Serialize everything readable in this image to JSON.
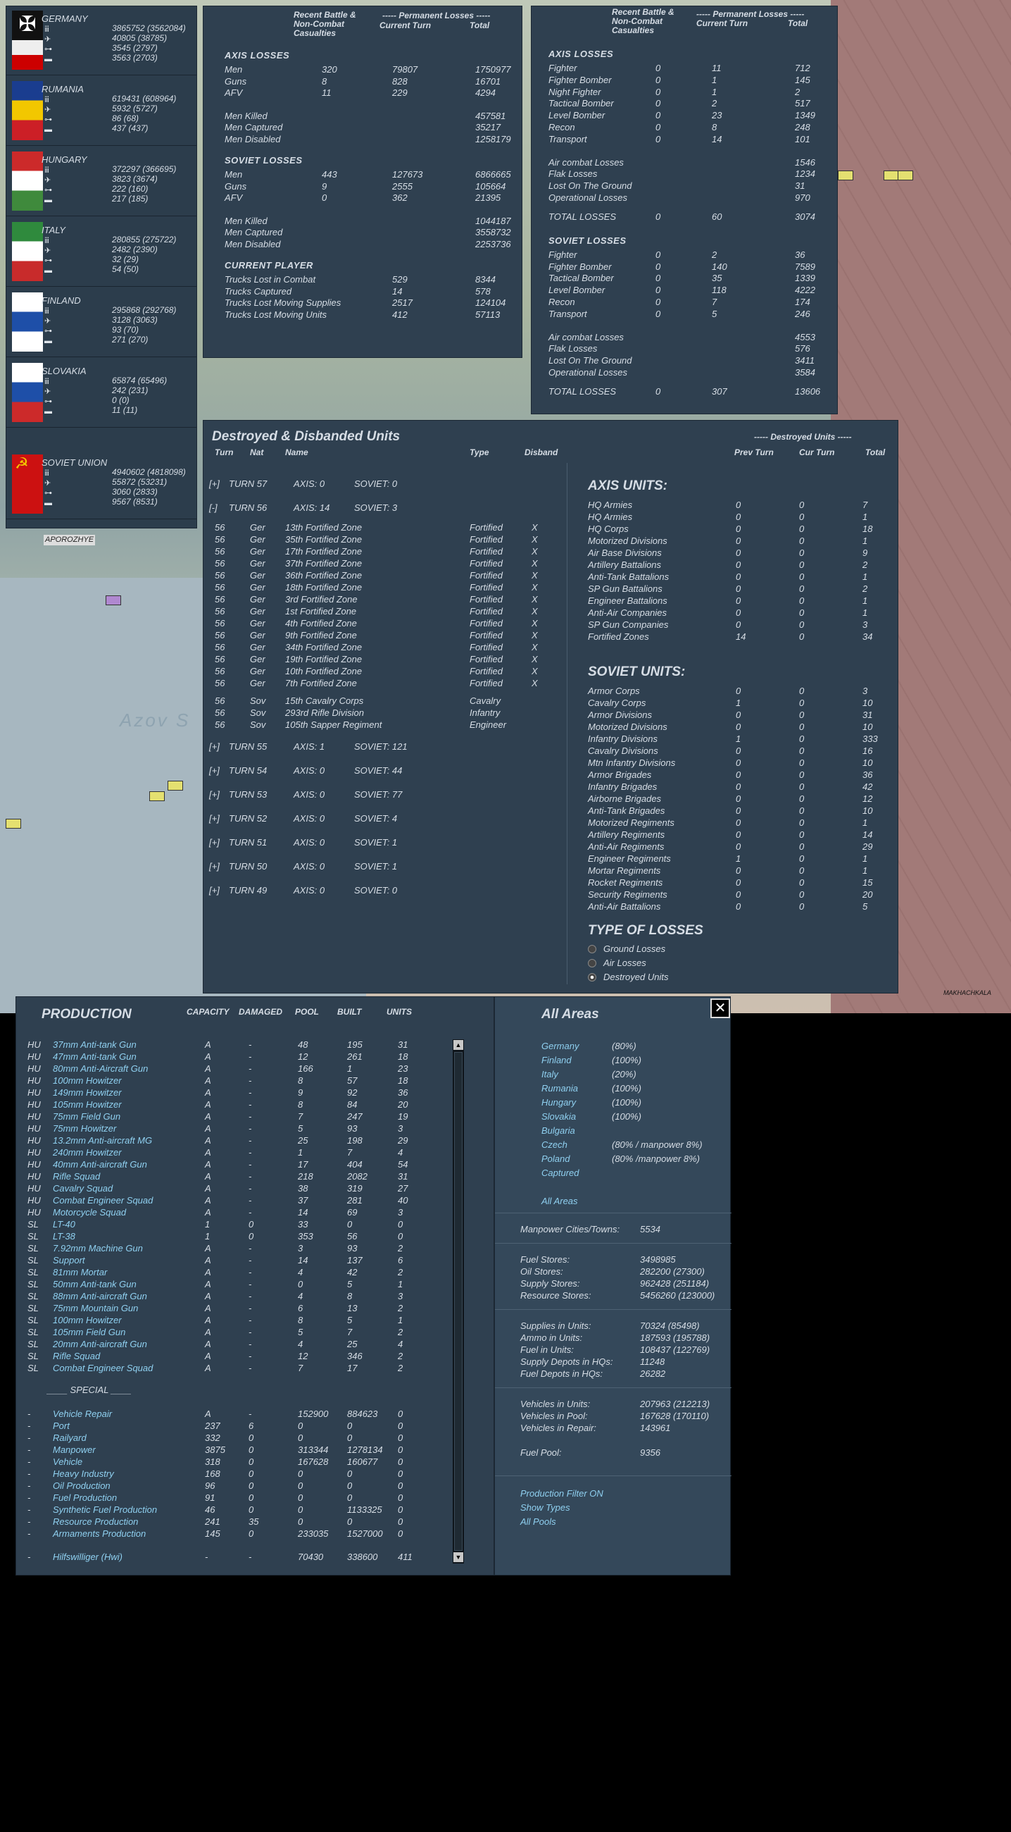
{
  "nations": [
    {
      "name": "GERMANY",
      "vals": [
        "3865752 (3562084)",
        "40805 (38785)",
        "3545 (2797)",
        "3563 (2703)"
      ],
      "flag": [
        "#000000",
        "#ffffff",
        "#cc0000"
      ]
    },
    {
      "name": "RUMANIA",
      "vals": [
        "619431 (608964)",
        "5932 (5727)",
        "86 (68)",
        "437 (437)"
      ],
      "flag": [
        "#1a3d8f",
        "#f2c700",
        "#cc1f26"
      ]
    },
    {
      "name": "HUNGARY",
      "vals": [
        "372297 (366695)",
        "3823 (3674)",
        "222 (160)",
        "217 (185)"
      ],
      "flag": [
        "#cc2a2a",
        "#ffffff",
        "#3f8a3c"
      ]
    },
    {
      "name": "ITALY",
      "vals": [
        "280855 (275722)",
        "2482 (2390)",
        "32 (29)",
        "54 (50)"
      ],
      "flag": [
        "#2f8a3d",
        "#ffffff",
        "#c82b2b"
      ]
    },
    {
      "name": "FINLAND",
      "vals": [
        "295868 (292768)",
        "3128 (3063)",
        "93 (70)",
        "271 (270)"
      ],
      "flag": [
        "#ffffff",
        "#1e4fa8",
        "#ffffff"
      ]
    },
    {
      "name": "SLOVAKIA",
      "vals": [
        "65874 (65496)",
        "242 (231)",
        "0 (0)",
        "11 (11)"
      ],
      "flag": [
        "#ffffff",
        "#1e4fa8",
        "#cc2a2a"
      ]
    },
    {
      "name": "SOVIET UNION",
      "vals": [
        "4940602 (4818098)",
        "55872 (53231)",
        "3060 (2833)",
        "9567 (8531)"
      ],
      "flag": [
        "#cc1111",
        "#cc1111",
        "#cc1111"
      ]
    }
  ],
  "ground": {
    "h1": "Recent Battle & Non-Combat Casualties",
    "h2": "----- Permanent Losses -----",
    "h2a": "Current Turn",
    "h2b": "Total",
    "axis_title": "AXIS LOSSES",
    "axis": [
      [
        "Men",
        "320",
        "79807",
        "1750977"
      ],
      [
        "Guns",
        "8",
        "828",
        "16701"
      ],
      [
        "AFV",
        "11",
        "229",
        "4294"
      ]
    ],
    "axis2": [
      [
        "Men Killed",
        "",
        "",
        "457581"
      ],
      [
        "Men Captured",
        "",
        "",
        "35217"
      ],
      [
        "Men Disabled",
        "",
        "",
        "1258179"
      ]
    ],
    "sov_title": "SOVIET LOSSES",
    "sov": [
      [
        "Men",
        "443",
        "127673",
        "6866665"
      ],
      [
        "Guns",
        "9",
        "2555",
        "105664"
      ],
      [
        "AFV",
        "0",
        "362",
        "21395"
      ]
    ],
    "sov2": [
      [
        "Men Killed",
        "",
        "",
        "1044187"
      ],
      [
        "Men Captured",
        "",
        "",
        "3558732"
      ],
      [
        "Men Disabled",
        "",
        "",
        "2253736"
      ]
    ],
    "cur_title": "CURRENT PLAYER",
    "cur": [
      [
        "Trucks Lost in Combat",
        "",
        "529",
        "8344"
      ],
      [
        "Trucks Captured",
        "",
        "14",
        "578"
      ],
      [
        "Trucks Lost Moving Supplies",
        "",
        "2517",
        "124104"
      ],
      [
        "Trucks Lost Moving Units",
        "",
        "412",
        "57113"
      ]
    ]
  },
  "air": {
    "h1": "Recent Battle & Non-Combat Casualties",
    "h2": "----- Permanent Losses -----",
    "h2a": "Current Turn",
    "h2b": "Total",
    "axis_title": "AXIS LOSSES",
    "axis": [
      [
        "Fighter",
        "0",
        "11",
        "712"
      ],
      [
        "Fighter Bomber",
        "0",
        "1",
        "145"
      ],
      [
        "Night Fighter",
        "0",
        "1",
        "2"
      ],
      [
        "Tactical Bomber",
        "0",
        "2",
        "517"
      ],
      [
        "Level Bomber",
        "0",
        "23",
        "1349"
      ],
      [
        "Recon",
        "0",
        "8",
        "248"
      ],
      [
        "Transport",
        "0",
        "14",
        "101"
      ]
    ],
    "axis2": [
      [
        "Air combat Losses",
        "",
        "",
        "1546"
      ],
      [
        "Flak Losses",
        "",
        "",
        "1234"
      ],
      [
        "Lost On The Ground",
        "",
        "",
        "31"
      ],
      [
        "Operational Losses",
        "",
        "",
        "970"
      ]
    ],
    "axis_total": [
      "TOTAL LOSSES",
      "0",
      "60",
      "3074"
    ],
    "sov_title": "SOVIET LOSSES",
    "sov": [
      [
        "Fighter",
        "0",
        "2",
        "36"
      ],
      [
        "Fighter Bomber",
        "0",
        "140",
        "7589"
      ],
      [
        "Tactical Bomber",
        "0",
        "35",
        "1339"
      ],
      [
        "Level Bomber",
        "0",
        "118",
        "4222"
      ],
      [
        "Recon",
        "0",
        "7",
        "174"
      ],
      [
        "Transport",
        "0",
        "5",
        "246"
      ]
    ],
    "sov2": [
      [
        "Air combat Losses",
        "",
        "",
        "4553"
      ],
      [
        "Flak Losses",
        "",
        "",
        "576"
      ],
      [
        "Lost On The Ground",
        "",
        "",
        "3411"
      ],
      [
        "Operational Losses",
        "",
        "",
        "3584"
      ]
    ],
    "sov_total": [
      "TOTAL LOSSES",
      "0",
      "307",
      "13606"
    ]
  },
  "destroyed": {
    "title": "Destroyed & Disbanded Units",
    "cols": [
      "Turn",
      "Nat",
      "Name",
      "Type",
      "Disband"
    ],
    "rcols": [
      "----- Destroyed Units -----",
      "Prev Turn",
      "Cur Turn",
      "Total"
    ],
    "turns_top": [
      [
        "[+]",
        "TURN 57",
        "AXIS: 0",
        "SOVIET: 0"
      ],
      [
        "[-]",
        "TURN 56",
        "AXIS: 14",
        "SOVIET: 3"
      ]
    ],
    "units": [
      [
        "56",
        "Ger",
        "13th Fortified Zone",
        "Fortified",
        "X"
      ],
      [
        "56",
        "Ger",
        "35th Fortified Zone",
        "Fortified",
        "X"
      ],
      [
        "56",
        "Ger",
        "17th Fortified Zone",
        "Fortified",
        "X"
      ],
      [
        "56",
        "Ger",
        "37th Fortified Zone",
        "Fortified",
        "X"
      ],
      [
        "56",
        "Ger",
        "36th Fortified Zone",
        "Fortified",
        "X"
      ],
      [
        "56",
        "Ger",
        "18th Fortified Zone",
        "Fortified",
        "X"
      ],
      [
        "56",
        "Ger",
        "3rd Fortified Zone",
        "Fortified",
        "X"
      ],
      [
        "56",
        "Ger",
        "1st Fortified Zone",
        "Fortified",
        "X"
      ],
      [
        "56",
        "Ger",
        "4th Fortified Zone",
        "Fortified",
        "X"
      ],
      [
        "56",
        "Ger",
        "9th Fortified Zone",
        "Fortified",
        "X"
      ],
      [
        "56",
        "Ger",
        "34th Fortified Zone",
        "Fortified",
        "X"
      ],
      [
        "56",
        "Ger",
        "19th Fortified Zone",
        "Fortified",
        "X"
      ],
      [
        "56",
        "Ger",
        "10th Fortified Zone",
        "Fortified",
        "X"
      ],
      [
        "56",
        "Ger",
        "7th Fortified Zone",
        "Fortified",
        "X"
      ],
      [
        "56",
        "Sov",
        "15th Cavalry Corps",
        "Cavalry",
        ""
      ],
      [
        "56",
        "Sov",
        "293rd Rifle Division",
        "Infantry",
        ""
      ],
      [
        "56",
        "Sov",
        "105th Sapper Regiment",
        "Engineer",
        ""
      ]
    ],
    "turns_bottom": [
      [
        "[+]",
        "TURN 55",
        "AXIS: 1",
        "SOVIET: 121"
      ],
      [
        "[+]",
        "TURN 54",
        "AXIS: 0",
        "SOVIET: 44"
      ],
      [
        "[+]",
        "TURN 53",
        "AXIS: 0",
        "SOVIET: 77"
      ],
      [
        "[+]",
        "TURN 52",
        "AXIS: 0",
        "SOVIET: 4"
      ],
      [
        "[+]",
        "TURN 51",
        "AXIS: 0",
        "SOVIET: 1"
      ],
      [
        "[+]",
        "TURN 50",
        "AXIS: 0",
        "SOVIET: 1"
      ],
      [
        "[+]",
        "TURN 49",
        "AXIS: 0",
        "SOVIET: 0"
      ]
    ],
    "axis_title": "AXIS UNITS:",
    "axis_units": [
      [
        "HQ Armies",
        "0",
        "0",
        "7"
      ],
      [
        "HQ Armies",
        "0",
        "0",
        "1"
      ],
      [
        "HQ Corps",
        "0",
        "0",
        "18"
      ],
      [
        "Motorized Divisions",
        "0",
        "0",
        "1"
      ],
      [
        "Air Base Divisions",
        "0",
        "0",
        "9"
      ],
      [
        "Artillery Battalions",
        "0",
        "0",
        "2"
      ],
      [
        "Anti-Tank Battalions",
        "0",
        "0",
        "1"
      ],
      [
        "SP Gun Battalions",
        "0",
        "0",
        "2"
      ],
      [
        "Engineer Battalions",
        "0",
        "0",
        "1"
      ],
      [
        "Anti-Air Companies",
        "0",
        "0",
        "1"
      ],
      [
        "SP Gun Companies",
        "0",
        "0",
        "3"
      ],
      [
        "Fortified Zones",
        "14",
        "0",
        "34"
      ]
    ],
    "sov_title": "SOVIET UNITS:",
    "sov_units": [
      [
        "Armor Corps",
        "0",
        "0",
        "3"
      ],
      [
        "Cavalry Corps",
        "1",
        "0",
        "10"
      ],
      [
        "Armor Divisions",
        "0",
        "0",
        "31"
      ],
      [
        "Motorized Divisions",
        "0",
        "0",
        "10"
      ],
      [
        "Infantry Divisions",
        "1",
        "0",
        "333"
      ],
      [
        "Cavalry Divisions",
        "0",
        "0",
        "16"
      ],
      [
        "Mtn Infantry Divisions",
        "0",
        "0",
        "10"
      ],
      [
        "Armor Brigades",
        "0",
        "0",
        "36"
      ],
      [
        "Infantry Brigades",
        "0",
        "0",
        "42"
      ],
      [
        "Airborne Brigades",
        "0",
        "0",
        "12"
      ],
      [
        "Anti-Tank Brigades",
        "0",
        "0",
        "10"
      ],
      [
        "Motorized Regiments",
        "0",
        "0",
        "1"
      ],
      [
        "Artillery Regiments",
        "0",
        "0",
        "14"
      ],
      [
        "Anti-Air Regiments",
        "0",
        "0",
        "29"
      ],
      [
        "Engineer Regiments",
        "1",
        "0",
        "1"
      ],
      [
        "Mortar Regiments",
        "0",
        "0",
        "1"
      ],
      [
        "Rocket Regiments",
        "0",
        "0",
        "15"
      ],
      [
        "Security Regiments",
        "0",
        "0",
        "20"
      ],
      [
        "Anti-Air Battalions",
        "0",
        "0",
        "5"
      ]
    ],
    "type_title": "TYPE OF LOSSES",
    "type_opts": [
      "Ground Losses",
      "Air Losses",
      "Destroyed Units"
    ]
  },
  "production": {
    "title": "PRODUCTION",
    "cols": [
      "CAPACITY",
      "DAMAGED",
      "POOL",
      "BUILT",
      "UNITS"
    ],
    "rows": [
      [
        "HU",
        "37mm Anti-tank Gun",
        "A",
        "-",
        "48",
        "195",
        "31"
      ],
      [
        "HU",
        "47mm Anti-tank Gun",
        "A",
        "-",
        "12",
        "261",
        "18"
      ],
      [
        "HU",
        "80mm Anti-Aircraft Gun",
        "A",
        "-",
        "166",
        "1",
        "23"
      ],
      [
        "HU",
        "100mm Howitzer",
        "A",
        "-",
        "8",
        "57",
        "18"
      ],
      [
        "HU",
        "149mm Howitzer",
        "A",
        "-",
        "9",
        "92",
        "36"
      ],
      [
        "HU",
        "105mm Howitzer",
        "A",
        "-",
        "8",
        "84",
        "20"
      ],
      [
        "HU",
        "75mm Field Gun",
        "A",
        "-",
        "7",
        "247",
        "19"
      ],
      [
        "HU",
        "75mm Howitzer",
        "A",
        "-",
        "5",
        "93",
        "3"
      ],
      [
        "HU",
        "13.2mm Anti-aircraft MG",
        "A",
        "-",
        "25",
        "198",
        "29"
      ],
      [
        "HU",
        "240mm Howitzer",
        "A",
        "-",
        "1",
        "7",
        "4"
      ],
      [
        "HU",
        "40mm Anti-aircraft Gun",
        "A",
        "-",
        "17",
        "404",
        "54"
      ],
      [
        "HU",
        "Rifle Squad",
        "A",
        "-",
        "218",
        "2082",
        "31"
      ],
      [
        "HU",
        "Cavalry Squad",
        "A",
        "-",
        "38",
        "319",
        "27"
      ],
      [
        "HU",
        "Combat Engineer Squad",
        "A",
        "-",
        "37",
        "281",
        "40"
      ],
      [
        "HU",
        "Motorcycle Squad",
        "A",
        "-",
        "14",
        "69",
        "3"
      ],
      [
        "SL",
        "LT-40",
        "1",
        "0",
        "33",
        "0",
        "0"
      ],
      [
        "SL",
        "LT-38",
        "1",
        "0",
        "353",
        "56",
        "0"
      ],
      [
        "SL",
        "7.92mm Machine Gun",
        "A",
        "-",
        "3",
        "93",
        "2"
      ],
      [
        "SL",
        "Support",
        "A",
        "-",
        "14",
        "137",
        "6"
      ],
      [
        "SL",
        "81mm Mortar",
        "A",
        "-",
        "4",
        "42",
        "2"
      ],
      [
        "SL",
        "50mm Anti-tank Gun",
        "A",
        "-",
        "0",
        "5",
        "1"
      ],
      [
        "SL",
        "88mm Anti-aircraft Gun",
        "A",
        "-",
        "4",
        "8",
        "3"
      ],
      [
        "SL",
        "75mm Mountain Gun",
        "A",
        "-",
        "6",
        "13",
        "2"
      ],
      [
        "SL",
        "100mm Howitzer",
        "A",
        "-",
        "8",
        "5",
        "1"
      ],
      [
        "SL",
        "105mm Field Gun",
        "A",
        "-",
        "5",
        "7",
        "2"
      ],
      [
        "SL",
        "20mm Anti-aircraft Gun",
        "A",
        "-",
        "4",
        "25",
        "4"
      ],
      [
        "SL",
        "Rifle Squad",
        "A",
        "-",
        "12",
        "346",
        "2"
      ],
      [
        "SL",
        "Combat Engineer Squad",
        "A",
        "-",
        "7",
        "17",
        "2"
      ]
    ],
    "special_title": "____ SPECIAL ____",
    "special": [
      [
        "-",
        "Vehicle Repair",
        "A",
        "-",
        "152900",
        "884623",
        "0"
      ],
      [
        "-",
        "Port",
        "237",
        "6",
        "0",
        "0",
        "0"
      ],
      [
        "-",
        "Railyard",
        "332",
        "0",
        "0",
        "0",
        "0"
      ],
      [
        "-",
        "Manpower",
        "3875",
        "0",
        "313344",
        "1278134",
        "0"
      ],
      [
        "-",
        "Vehicle",
        "318",
        "0",
        "167628",
        "160677",
        "0"
      ],
      [
        "-",
        "Heavy Industry",
        "168",
        "0",
        "0",
        "0",
        "0"
      ],
      [
        "-",
        "Oil Production",
        "96",
        "0",
        "0",
        "0",
        "0"
      ],
      [
        "-",
        "Fuel Production",
        "91",
        "0",
        "0",
        "0",
        "0"
      ],
      [
        "-",
        "Synthetic Fuel Production",
        "46",
        "0",
        "0",
        "1133325",
        "0"
      ],
      [
        "-",
        "Resource Production",
        "241",
        "35",
        "0",
        "0",
        "0"
      ],
      [
        "-",
        "Armaments Production",
        "145",
        "0",
        "233035",
        "1527000",
        "0"
      ]
    ],
    "last": [
      "-",
      "Hilfswilliger (Hwi)",
      "-",
      "-",
      "70430",
      "338600",
      "411"
    ]
  },
  "areas": {
    "title": "All Areas",
    "list": [
      [
        "Germany",
        "(80%)"
      ],
      [
        "Finland",
        "(100%)"
      ],
      [
        "Italy",
        "(20%)"
      ],
      [
        "Rumania",
        "(100%)"
      ],
      [
        "Hungary",
        "(100%)"
      ],
      [
        "Slovakia",
        "(100%)"
      ],
      [
        "Bulgaria",
        ""
      ],
      [
        "Czech",
        "(80% / manpower 8%)"
      ],
      [
        "Poland",
        "(80% /manpower 8%)"
      ],
      [
        "Captured",
        ""
      ]
    ],
    "all": "All Areas",
    "g1": [
      [
        "Manpower Cities/Towns:",
        "5534"
      ]
    ],
    "g2": [
      [
        "Fuel Stores:",
        "3498985"
      ],
      [
        "Oil Stores:",
        "282200 (27300)"
      ],
      [
        "Supply Stores:",
        "962428 (251184)"
      ],
      [
        "Resource Stores:",
        "5456260 (123000)"
      ]
    ],
    "g3": [
      [
        "Supplies in Units:",
        "70324 (85498)"
      ],
      [
        "Ammo in Units:",
        "187593 (195788)"
      ],
      [
        "Fuel in Units:",
        "108437 (122769)"
      ],
      [
        "Supply Depots in HQs:",
        "11248"
      ],
      [
        "Fuel Depots in HQs:",
        "26282"
      ]
    ],
    "g4": [
      [
        "Vehicles in Units:",
        "207963 (212213)"
      ],
      [
        "Vehicles in Pool:",
        "167628 (170110)"
      ],
      [
        "Vehicles in Repair:",
        "143961"
      ]
    ],
    "g5": [
      [
        "Fuel Pool:",
        "9356"
      ]
    ],
    "links": [
      "Production Filter ON",
      "Show Types",
      "All Pools"
    ],
    "close": "✕"
  },
  "map_labels": {
    "azov": "Azov S",
    "city": "APOROZHYE",
    "makh": "MAKHACHKALA"
  }
}
